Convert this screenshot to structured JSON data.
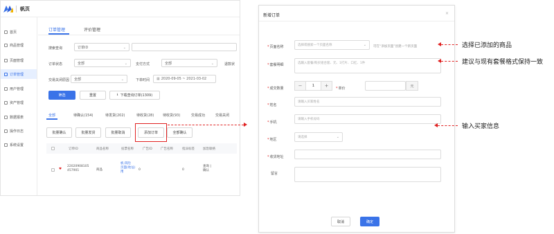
{
  "app": {
    "brand": "帆页"
  },
  "sidebar": {
    "items": [
      {
        "label": "首页",
        "icon": "home-icon"
      },
      {
        "label": "商品管理",
        "icon": "box-icon"
      },
      {
        "label": "页面管理",
        "icon": "page-icon"
      },
      {
        "label": "订单管理",
        "icon": "order-icon",
        "active": true
      },
      {
        "label": "用户管理",
        "icon": "user-icon"
      },
      {
        "label": "资产管理",
        "icon": "wallet-icon"
      },
      {
        "label": "数据报表",
        "icon": "chart-icon"
      },
      {
        "label": "操作日志",
        "icon": "log-icon"
      },
      {
        "label": "系统设置",
        "icon": "gear-icon"
      }
    ]
  },
  "main": {
    "tabs": [
      {
        "label": "订单管理",
        "active": true
      },
      {
        "label": "评价管理"
      }
    ],
    "filters": {
      "search_label": "搜索查询",
      "search_type": "订单ID",
      "order_status_label": "订单状态",
      "order_status_value": "全部",
      "pay_method_label": "支付方式",
      "pay_method_value": "全部",
      "refund_label": "退款状",
      "close_type_label": "交易关闭原因",
      "close_type_value": "全部",
      "order_time_label": "下单时间",
      "order_time_value": "2020-09-05 ~ 2021-03-02"
    },
    "buttons": {
      "filter": "筛选",
      "reset": "重置",
      "download": "下载查询订单(1309)"
    },
    "status_tabs": [
      {
        "label": "全部",
        "active": true
      },
      {
        "label": "待确认(154)"
      },
      {
        "label": "待发货(202)"
      },
      {
        "label": "待收货(28)"
      },
      {
        "label": "待收货(93)"
      },
      {
        "label": "交易成功"
      },
      {
        "label": "交易关闭"
      }
    ],
    "actions": [
      "批量确认",
      "批量发货",
      "批量取消",
      "添加订单",
      "全部确认"
    ],
    "table": {
      "headers": [
        "订单ID",
        "商品名称",
        "投票名称",
        "广告ID",
        "广告名称",
        "指派标签",
        "加急联络"
      ],
      "rows": [
        {
          "id_line1": "22020908105",
          "id_line2": "457901",
          "product": "商品",
          "vote_line1": "帆·风险",
          "vote_line2": "页面(地址)",
          "vote_line3": "用",
          "ad_id": "0",
          "tag": "0",
          "urgent_line1": "查询 |",
          "urgent_line2": "确认"
        }
      ]
    }
  },
  "dialog": {
    "title": "新增订单",
    "close": "×",
    "fields": {
      "page_name": {
        "label": "页面名称",
        "placeholder": "选择或搜索一个页面名称",
        "hint": "可在“添加页面”创建一个新页面"
      },
      "package_desc": {
        "label": "套餐明细",
        "placeholder": "选输入套餐/购买组合套、元、1打片、口红、1件"
      },
      "quantity": {
        "label": "成交数量",
        "minus": "−",
        "value": "1",
        "plus": "+",
        "unit_price_label": "单价",
        "currency": "元"
      },
      "name": {
        "label": "姓名",
        "placeholder": "请输入买家姓名"
      },
      "phone": {
        "label": "手机",
        "placeholder": "请输入手机号码"
      },
      "region": {
        "label": "地区",
        "placeholder": "请选择"
      },
      "address": {
        "label": "收货地址"
      },
      "remark": {
        "label": "留言"
      }
    },
    "buttons": {
      "cancel": "取消",
      "confirm": "确定"
    }
  },
  "annotations": {
    "select_product": "选择已添加的商品",
    "package_format": "建议与现有套餐格式保持一致",
    "buyer_info": "输入买家信息"
  },
  "colors": {
    "accent": "#3a73e8",
    "highlight": "#e02020"
  }
}
